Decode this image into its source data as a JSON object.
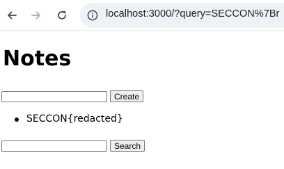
{
  "browser": {
    "back_icon": "arrow-left-icon",
    "forward_icon": "arrow-right-icon",
    "reload_icon": "reload-icon",
    "site_info_icon": "info-icon",
    "url": "localhost:3000/?query=SECCON%7Br"
  },
  "page": {
    "title": "Notes",
    "create_form": {
      "input_value": "",
      "button_label": "Create"
    },
    "notes": [
      {
        "text": "SECCON{redacted}"
      }
    ],
    "search_form": {
      "input_value": "",
      "button_label": "Search"
    }
  },
  "colors": {
    "toolbar_background": "#ffffff",
    "address_bar_background": "#eef1f8",
    "text": "#000000",
    "button_background": "#efefef",
    "field_border": "#767676"
  }
}
